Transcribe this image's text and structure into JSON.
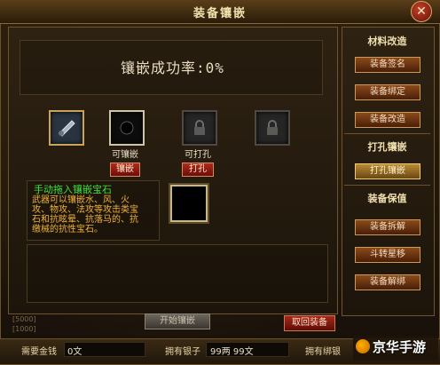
{
  "window": {
    "title": "装备镶嵌",
    "close_icon": "close-icon"
  },
  "main": {
    "success_rate_label": "镶嵌成功率:0%",
    "slots": [
      {
        "state": "equipment",
        "label": "",
        "button": ""
      },
      {
        "state": "hole",
        "label": "可镶嵌",
        "button": "镶嵌"
      },
      {
        "state": "locked",
        "label": "可打孔",
        "button": "打孔"
      },
      {
        "state": "locked",
        "label": "",
        "button": ""
      }
    ],
    "hint": {
      "title": "手动拖入镶嵌宝石",
      "description": "武器可以镶嵌水、风、火攻、物攻、法攻等攻击类宝石和抗眩晕、抗落马的、抗缴械的抗性宝石。"
    },
    "side_tags": [
      "[5000]",
      "[1000]"
    ],
    "start_button": "开始镶嵌",
    "retrieve_button": "取回装备"
  },
  "bottom": {
    "required_money_label": "需要金钱",
    "required_money_value": "0文",
    "silver_label": "拥有银子",
    "silver_value": "99两  99文",
    "bound_label": "拥有绑银"
  },
  "sidebar": {
    "sections": [
      {
        "title": "材料改造",
        "buttons": [
          "装备签名",
          "装备绑定",
          "装备改造"
        ]
      },
      {
        "title": "打孔镶嵌",
        "buttons": [
          "打孔镶嵌"
        ]
      },
      {
        "title": "装备保值",
        "buttons": [
          "装备拆解",
          "斗转星移",
          "装备解绑"
        ]
      }
    ]
  },
  "watermark": {
    "text": "京华手游"
  },
  "colors": {
    "accent_gold": "#c9a55a",
    "button_red": "#b02a1c",
    "hint_green": "#3fe03a",
    "hint_orange": "#f0b23a"
  }
}
